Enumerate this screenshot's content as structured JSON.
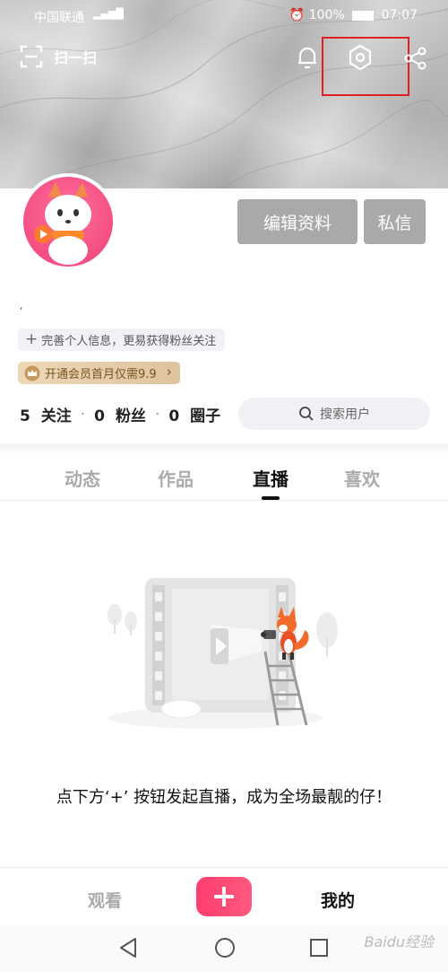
{
  "status_bar": {
    "carrier": "中国联通",
    "battery": "100%",
    "time": "07:07"
  },
  "header": {
    "scan_label": "扫一扫"
  },
  "profile": {
    "edit_button": "编辑资料",
    "message_button": "私信",
    "name_text": ",",
    "complete_info_chip": "完善个人信息，更易获得粉丝关注",
    "vip_promo": "开通会员首月仅需9.9",
    "stats": [
      {
        "count": "5",
        "label": "关注"
      },
      {
        "count": "0",
        "label": "粉丝"
      },
      {
        "count": "0",
        "label": "圈子"
      }
    ],
    "search_users": "搜索用户"
  },
  "tabs": [
    {
      "label": "动态"
    },
    {
      "label": "作品"
    },
    {
      "label": "直播",
      "active": true
    },
    {
      "label": "喜欢"
    }
  ],
  "empty_state": {
    "message": "点下方‘+’ 按钮发起直播，成为全场最靓的仔！"
  },
  "bottom_nav": {
    "watch": "观看",
    "mine": "我的"
  },
  "watermark": "Baidu经验",
  "colors": {
    "accent": "#ff3d6e",
    "highlight": "#e02020",
    "button_gray": "#a9a9a9"
  }
}
